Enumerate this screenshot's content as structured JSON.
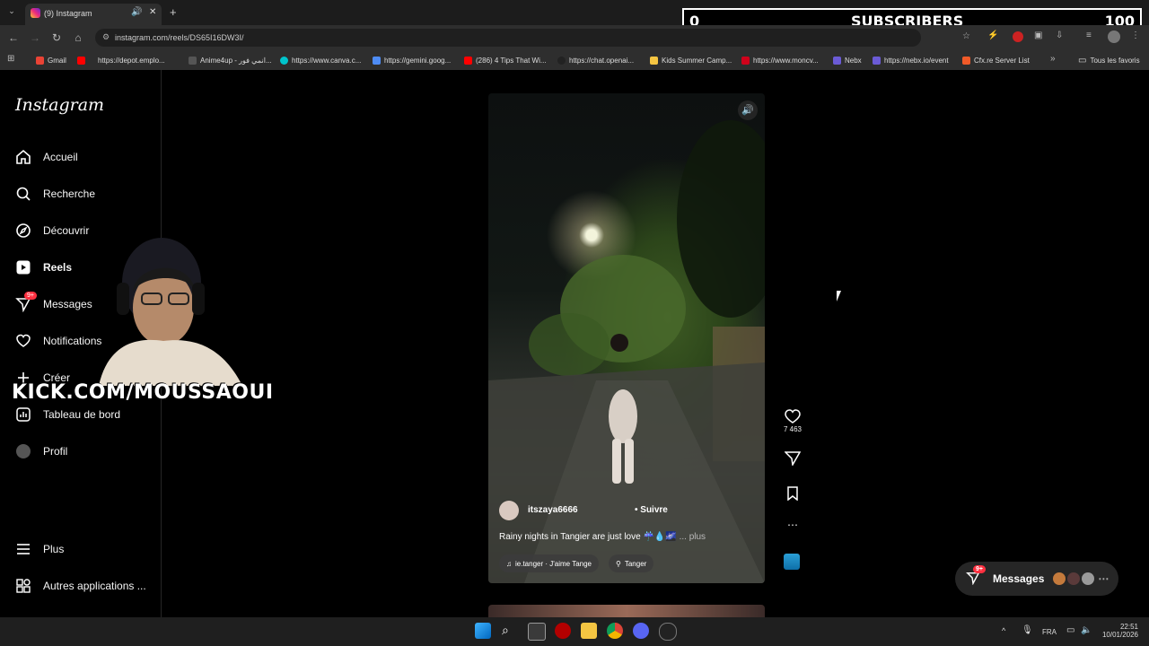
{
  "browser": {
    "tab_title": "(9) Instagram",
    "tab_badge": "9",
    "url": "instagram.com/reels/DS65I16DW3I/",
    "bookmarks": [
      {
        "label": "Gmail",
        "color": "#ea4335"
      },
      {
        "label": "https://depot.emplo...",
        "color": "#ff0000"
      },
      {
        "label": "Anime4up - انمي فور...",
        "color": "#555555"
      },
      {
        "label": "https://www.canva.c...",
        "color": "#00c4cc"
      },
      {
        "label": "https://gemini.goog...",
        "color": "#4e8cf5"
      },
      {
        "label": "(286) 4 Tips That Wi...",
        "color": "#ff0000"
      },
      {
        "label": "https://chat.openai...",
        "color": "#222222"
      },
      {
        "label": "Kids Summer Camp...",
        "color": "#f5c542"
      },
      {
        "label": "https://www.moncv...",
        "color": "#d0021b"
      },
      {
        "label": "Nebx",
        "color": "#6b5bd6"
      },
      {
        "label": "https://nebx.io/event",
        "color": "#6b5bd6"
      },
      {
        "label": "Cfx.re Server List",
        "color": "#f05a28"
      }
    ],
    "all_bookmarks_label": "Tous les favoris"
  },
  "overlay": {
    "subscribers_current": "0",
    "subscribers_label": "SUBSCRIBERS",
    "subscribers_goal": "100",
    "kick_text": "KICK.COM/MOUSSAOUI"
  },
  "sidebar": {
    "logo": "Instagram",
    "items": [
      {
        "label": "Accueil",
        "icon": "home-icon"
      },
      {
        "label": "Recherche",
        "icon": "search-icon"
      },
      {
        "label": "Découvrir",
        "icon": "compass-icon"
      },
      {
        "label": "Reels",
        "icon": "reels-icon"
      },
      {
        "label": "Messages",
        "icon": "send-icon",
        "badge": "9+"
      },
      {
        "label": "Notifications",
        "icon": "heart-icon"
      },
      {
        "label": "Créer",
        "icon": "plus-icon"
      },
      {
        "label": "Tableau de bord",
        "icon": "dashboard-icon"
      },
      {
        "label": "Profil",
        "icon": "avatar"
      }
    ],
    "more_label": "Plus",
    "apps_label": "Autres applications ..."
  },
  "reel": {
    "username": "itszaya6666",
    "follow_label": "Suivre",
    "caption": "Rainy nights in Tangier are just love ☔️💧🌌",
    "more_label": "... plus",
    "audio": "ie.tanger · J'aime Tange",
    "location": "Tanger",
    "likes": "7 463"
  },
  "messages_bar": {
    "label": "Messages",
    "badge": "9+"
  },
  "taskbar": {
    "language": "FRA",
    "time": "22:51",
    "date": "10/01/2026"
  }
}
